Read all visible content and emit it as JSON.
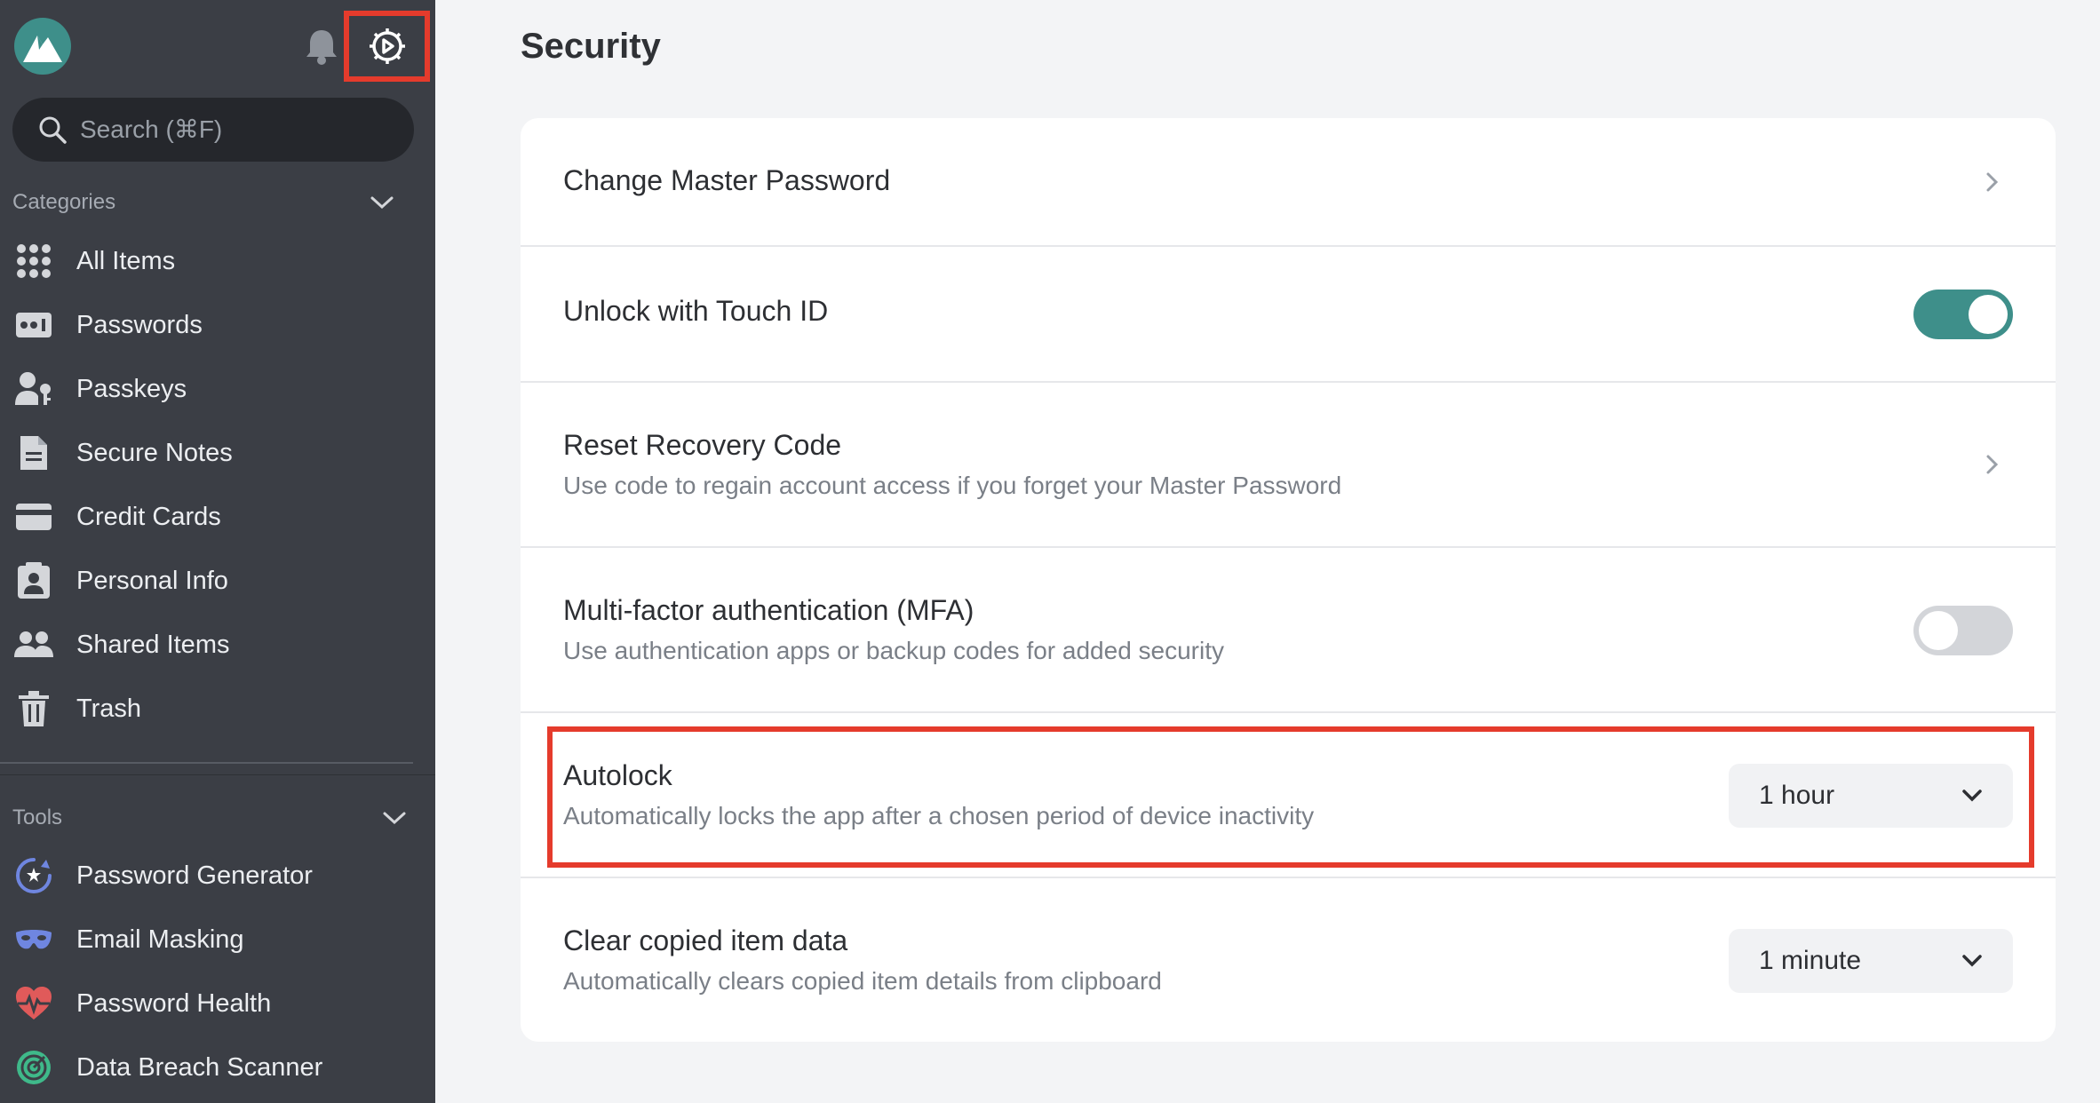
{
  "sidebar": {
    "search": {
      "placeholder": "Search (⌘F)"
    },
    "categories_label": "Categories",
    "categories": [
      {
        "label": "All Items",
        "icon": "grid-icon"
      },
      {
        "label": "Passwords",
        "icon": "password-icon"
      },
      {
        "label": "Passkeys",
        "icon": "passkey-icon"
      },
      {
        "label": "Secure Notes",
        "icon": "note-icon"
      },
      {
        "label": "Credit Cards",
        "icon": "credit-card-icon"
      },
      {
        "label": "Personal Info",
        "icon": "id-card-icon"
      },
      {
        "label": "Shared Items",
        "icon": "users-icon"
      },
      {
        "label": "Trash",
        "icon": "trash-icon"
      }
    ],
    "tools_label": "Tools",
    "tools": [
      {
        "label": "Password Generator",
        "icon": "generator-icon"
      },
      {
        "label": "Email Masking",
        "icon": "mask-icon"
      },
      {
        "label": "Password Health",
        "icon": "heart-pulse-icon"
      },
      {
        "label": "Data Breach Scanner",
        "icon": "radar-icon"
      }
    ]
  },
  "main": {
    "title": "Security",
    "rows": [
      {
        "title": "Change Master Password"
      },
      {
        "title": "Unlock with Touch ID",
        "toggle": true
      },
      {
        "title": "Reset Recovery Code",
        "subtitle": "Use code to regain account access if you forget your Master Password"
      },
      {
        "title": "Multi-factor authentication (MFA)",
        "subtitle": "Use authentication apps or backup codes for added security",
        "toggle": false
      },
      {
        "title": "Autolock",
        "subtitle": "Automatically locks the app after a chosen period of device inactivity",
        "value": "1 hour"
      },
      {
        "title": "Clear copied item data",
        "subtitle": "Automatically clears copied item details from clipboard",
        "value": "1 minute"
      }
    ]
  },
  "colors": {
    "accent": "#3e8f8a",
    "highlight": "#e53b2c",
    "sidebar_bg": "#3b3e45"
  }
}
